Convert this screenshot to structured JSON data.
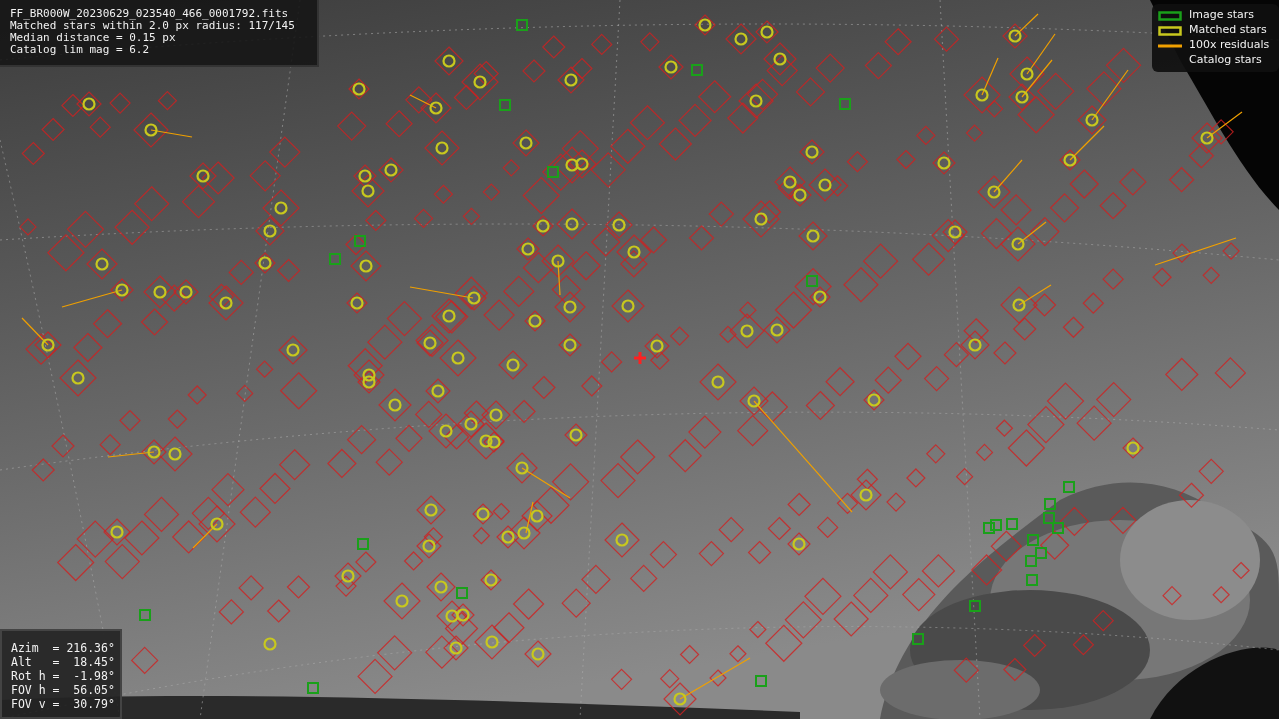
{
  "file_info": {
    "lines": [
      "FF_BR000W_20230629_023540_466_0001792.fits",
      "Matched stars within 2.0 px radius: 117/145",
      "Median distance = 0.15 px",
      "Catalog lim mag = 6.2"
    ]
  },
  "legend": {
    "items": [
      {
        "label": "Image stars",
        "kind": "box",
        "color": "#1aa01a"
      },
      {
        "label": "Matched stars",
        "kind": "box",
        "color": "#c8c81e"
      },
      {
        "label": "100x residuals",
        "kind": "line",
        "color": "#f0a000"
      },
      {
        "label": "Catalog stars",
        "kind": "none"
      }
    ]
  },
  "pointing": {
    "lines": [
      "Azim  = 216.36°",
      "Alt   =  18.45°",
      "Rot h =  -1.98°",
      "FOV h =  56.05°",
      "FOV v =  30.79°"
    ]
  }
}
